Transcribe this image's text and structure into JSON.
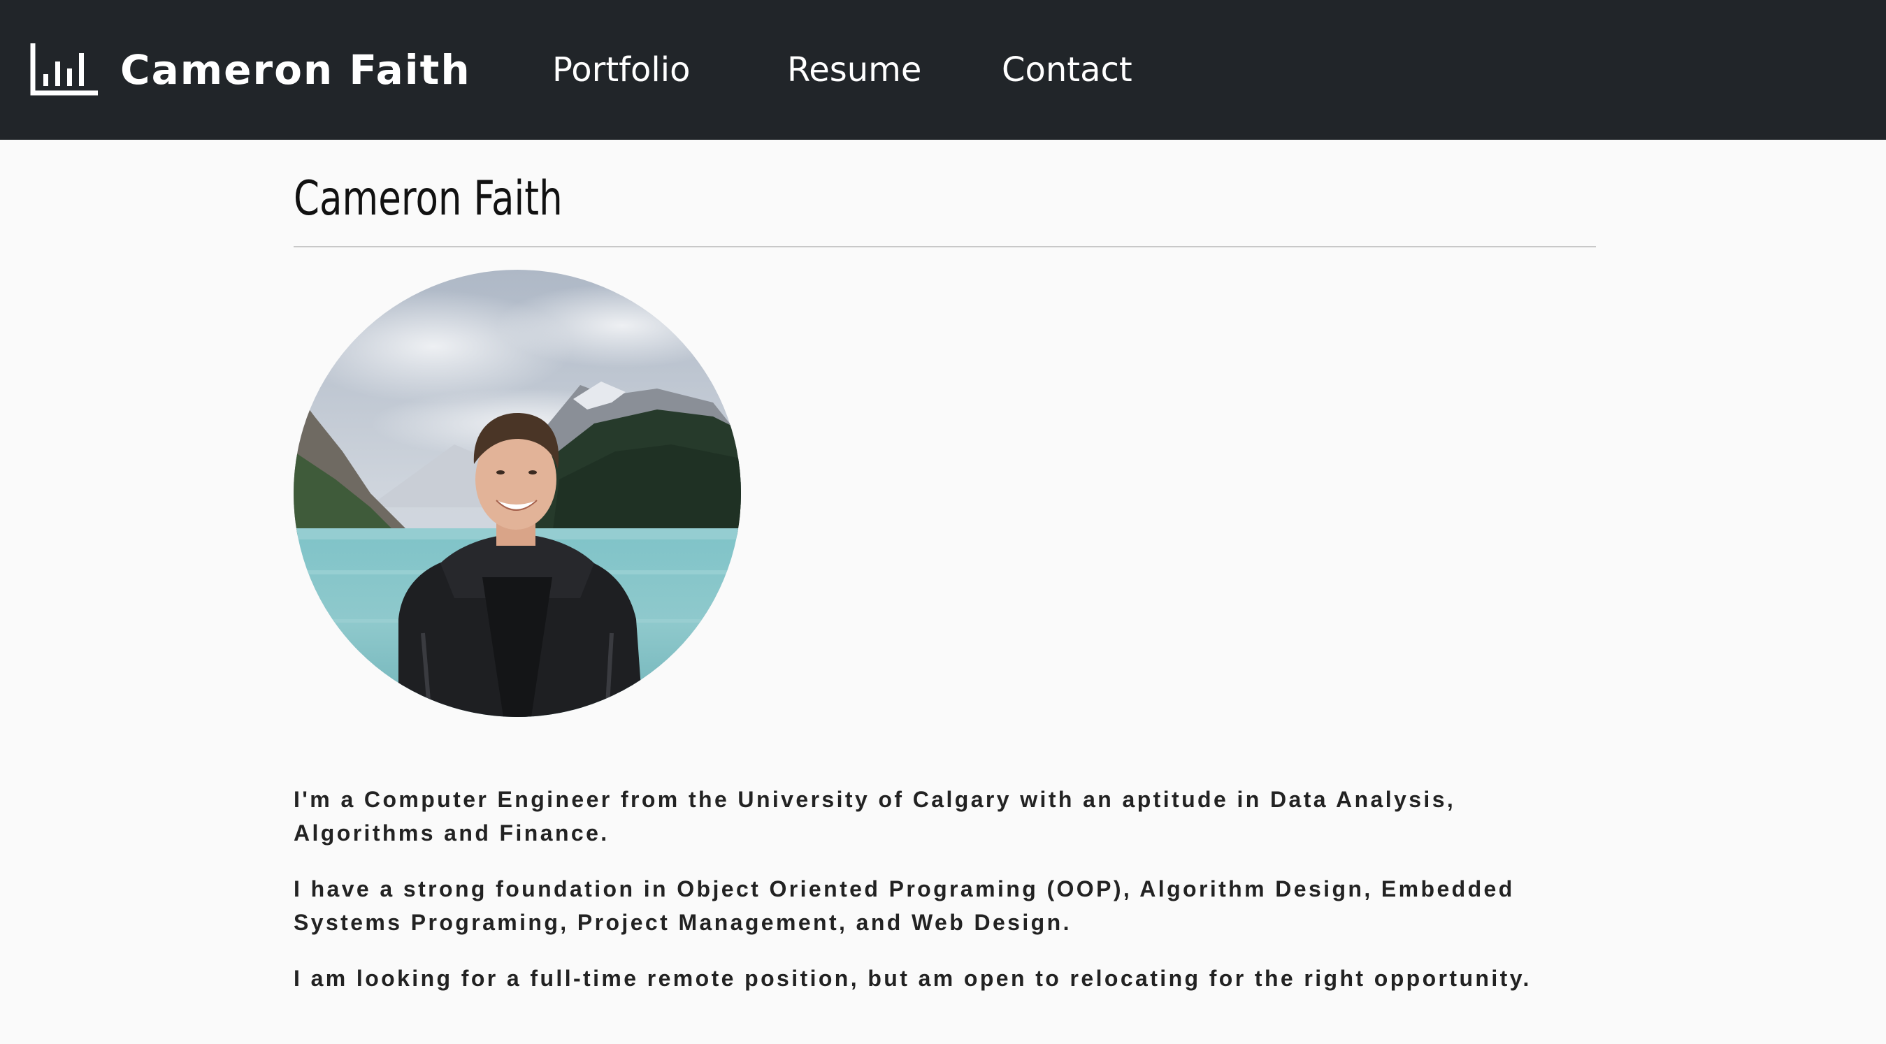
{
  "navbar": {
    "brand": {
      "icon": "bar-chart-icon",
      "name": "Cameron Faith"
    },
    "links": [
      {
        "label": "Portfolio"
      },
      {
        "label": "Resume"
      },
      {
        "label": "Contact"
      }
    ],
    "background": "#212529",
    "text_color": "#ffffff"
  },
  "main": {
    "title": "Cameron Faith",
    "avatar": {
      "image": "profile-photo"
    },
    "bio": [
      "I'm a Computer Engineer from the University of Calgary with an aptitude in Data Analysis, Algorithms and Finance.",
      "I have a strong foundation in Object Oriented Programing (OOP), Algorithm Design, Embedded Systems Programing, Project Management, and Web Design.",
      "I am looking for a full-time remote position, but am open to relocating for the right opportunity."
    ]
  },
  "colors": {
    "page_background": "#fafafa",
    "text": "#222222",
    "rule": "#c8c8c8"
  }
}
